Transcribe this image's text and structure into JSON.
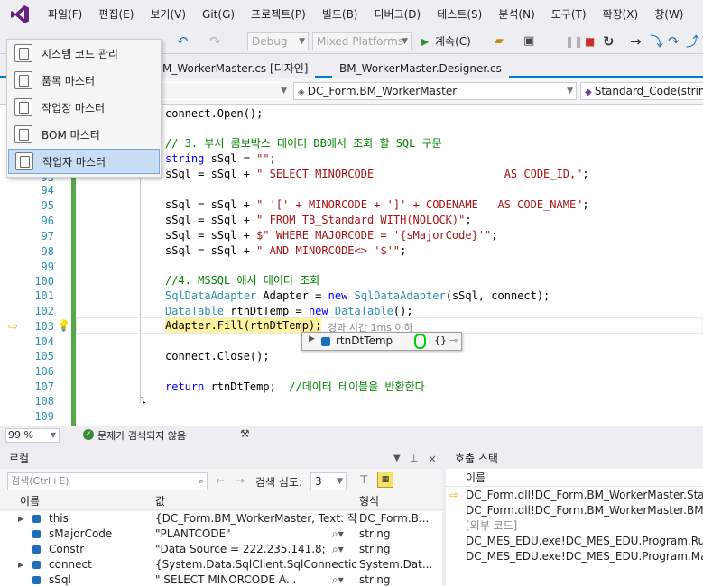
{
  "menu": [
    "파일(F)",
    "편집(E)",
    "보기(V)",
    "Git(G)",
    "프로젝트(P)",
    "빌드(B)",
    "디버그(D)",
    "테스트(S)",
    "분석(N)",
    "도구(T)",
    "확장(X)",
    "창(W)"
  ],
  "toolbar": {
    "config": "Debug",
    "platform": "Mixed Platforms",
    "continue": "계속(C)"
  },
  "tabs": {
    "tab1": "M_WorkerMaster.cs [디자인]",
    "tab2": "BM_WorkerMaster.Designer.cs"
  },
  "navbar": {
    "class": "DC_Form.BM_WorkerMaster",
    "member": "Standard_Code(string"
  },
  "context_menu": [
    "시스템 코드 관리",
    "품목 마스터",
    "작업장 마스터",
    "BOM 마스터",
    "작업자 마스터"
  ],
  "code": {
    "l0": "connect.Open();",
    "l1": "// 3. 부서 콤보박스 데이터 DB에서 조회 할 SQL 구문",
    "l2a": "string",
    "l2b": " sSql = ",
    "l2c": "\"\"",
    "l2d": ";",
    "l3a": "sSql = sSql + ",
    "l3b": "\" SELECT MINORCODE                    AS CODE_ID,\"",
    "l3c": ";",
    "l95a": "sSql = sSql + ",
    "l95b": "\" '[' + MINORCODE + ']' + CODENAME   AS CODE_NAME\"",
    "l95c": ";",
    "l96a": "sSql = sSql + ",
    "l96b": "\" FROM TB_Standard WITH(NOLOCK)\"",
    "l96c": ";",
    "l97a": "sSql = sSql + ",
    "l97b": "$\" WHERE MAJORCODE = '{sMajorCode}'\"",
    "l97c": ";",
    "l98a": "sSql = sSql + ",
    "l98b": "\" AND MINORCODE<> '$'\"",
    "l98c": ";",
    "l100": "//4. MSSQL 에서 데이터 조회",
    "l101a": "SqlDataAdapter",
    "l101b": " Adapter = ",
    "l101c": "new",
    "l101d": " ",
    "l101e": "SqlDataAdapter",
    "l101f": "(sSql, connect);",
    "l102a": "DataTable",
    "l102b": " rtnDtTemp = ",
    "l102c": "new",
    "l102d": " ",
    "l102e": "DataTable",
    "l102f": "();",
    "l103": "Adapter.Fill(rtnDtTemp);",
    "l103tip": "경과 시간 1ms 이하",
    "l105": "connect.Close();",
    "l107a": "return",
    "l107b": " rtnDtTemp;  ",
    "l107c": "//데이터 테이블을 반환한다",
    "l108": "}"
  },
  "line_numbers": [
    "93",
    "94",
    "95",
    "96",
    "97",
    "98",
    "99",
    "100",
    "101",
    "102",
    "103",
    "104",
    "105",
    "106",
    "107",
    "108",
    "109"
  ],
  "datatip": {
    "name": "rtnDtTemp",
    "value": "{}"
  },
  "editstatus": {
    "zoom": "99 %",
    "issues": "문제가 검색되지 않음"
  },
  "locals": {
    "title": "로컬",
    "search_placeholder": "검색(Ctrl+E)",
    "depth_label": "검색 심도:",
    "depth_value": "3",
    "headers": [
      "이름",
      "값",
      "형식"
    ],
    "rows": [
      {
        "name": "this",
        "value": "{DC_Form.BM_WorkerMaster, Text: 작업...",
        "type": "DC_Form.B..."
      },
      {
        "name": "sMajorCode",
        "value": "\"PLANTCODE\"",
        "type": "string"
      },
      {
        "name": "Constr",
        "value": "\"Data Source = 222.235.141.8; Initia...",
        "type": "string"
      },
      {
        "name": "connect",
        "value": "{System.Data.SqlClient.SqlConnection}",
        "type": "System.Dat..."
      },
      {
        "name": "sSql",
        "value": "\" SELECT MINORCODE           A...",
        "type": "string"
      }
    ]
  },
  "callstack": {
    "title": "호출 스택",
    "header": "이름",
    "rows": [
      "DC_Form.dll!DC_Form.BM_WorkerMaster.Standard",
      "DC_Form.dll!DC_Form.BM_WorkerMaster.BM_Wor",
      "[외부 코드]",
      "DC_MES_EDU.exe!DC_MES_EDU.Program.RunAppl",
      "DC_MES_EDU.exe!DC_MES_EDU.Program.Main() 줄"
    ]
  }
}
